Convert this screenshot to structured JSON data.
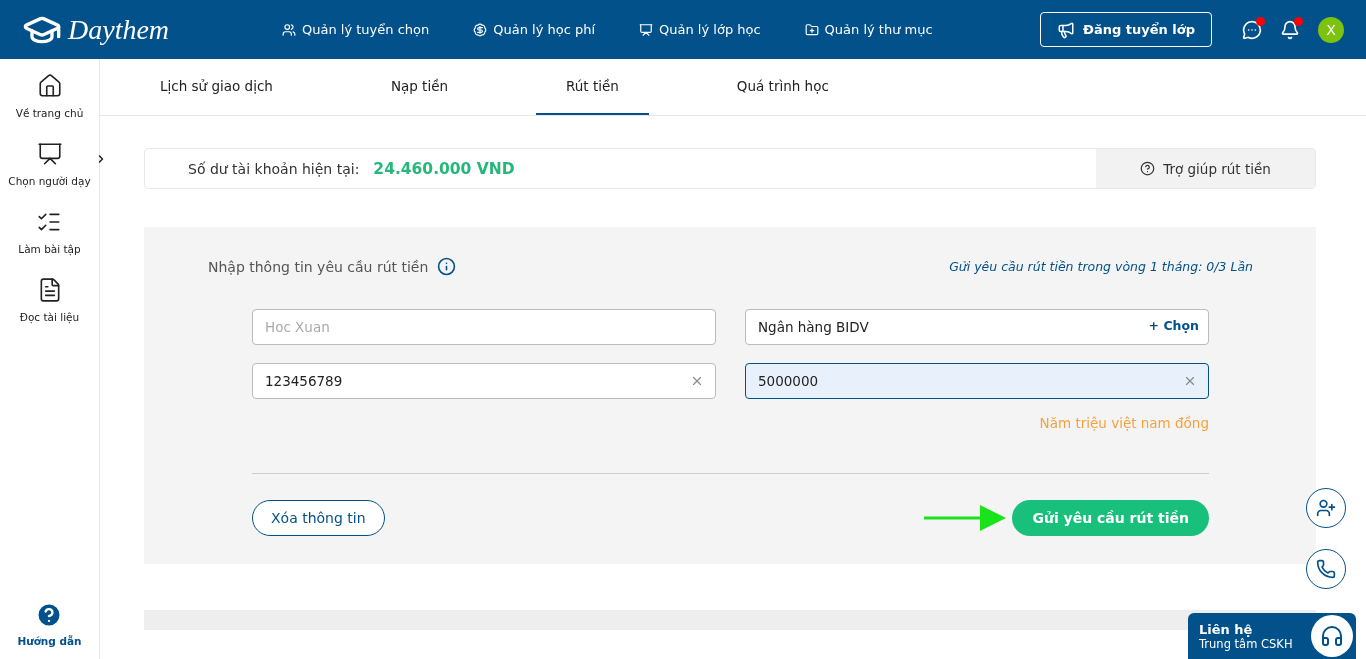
{
  "header": {
    "logo": "Daythem",
    "nav": [
      {
        "kind": "people",
        "label": "Quản lý tuyển chọn"
      },
      {
        "kind": "money",
        "label": "Quản lý học phí"
      },
      {
        "kind": "board",
        "label": "Quản lý lớp học"
      },
      {
        "kind": "folder",
        "label": "Quản lý thư mục"
      }
    ],
    "post_button": "Đăng tuyển lớp",
    "icons": [
      {
        "kind": "chat",
        "badge": true
      },
      {
        "kind": "bell",
        "badge": true
      }
    ],
    "avatar": "X"
  },
  "sidebar": {
    "items": [
      {
        "kind": "home",
        "label": "Về trang chủ",
        "submenu": false
      },
      {
        "kind": "teacher",
        "label": "Chọn người dạy",
        "submenu": true
      },
      {
        "kind": "exercise",
        "label": "Làm bài tập",
        "submenu": false
      },
      {
        "kind": "pdf",
        "label": "Đọc tài liệu",
        "submenu": false
      }
    ],
    "help": "Hướng dẫn"
  },
  "tabs": [
    {
      "label": "Lịch sử giao dịch",
      "selected": false
    },
    {
      "label": "Nạp tiền",
      "selected": false
    },
    {
      "label": "Rút tiền",
      "selected": true
    },
    {
      "label": "Quá trình học",
      "selected": false
    }
  ],
  "balance": {
    "label": "Số dư tài khoản hiện tại:",
    "amount": "24.460.000 VND",
    "help": "Trợ giúp rút tiền"
  },
  "form": {
    "title": "Nhập thông tin yêu cầu rút tiền",
    "limit": "Gửi yêu cầu rút tiền trong vòng 1 tháng: 0/3 Lần",
    "fields": [
      {
        "kind": "text",
        "placeholder": "Hoc Xuan",
        "focused": false
      },
      {
        "kind": "select",
        "value": "Ngân hàng BIDV",
        "action": "+ Chọn",
        "focused": false
      },
      {
        "kind": "clearable",
        "value": "123456789",
        "focused": false
      },
      {
        "kind": "clearable",
        "value": "5000000",
        "focused": true
      }
    ],
    "amount_words": "Năm triệu việt nam đồng",
    "clear_button": "Xóa thông tin",
    "submit_button": "Gửi yêu cầu rút tiền"
  },
  "contact": {
    "title": "Liên hệ",
    "subtitle": "Trung tâm CSKH"
  }
}
